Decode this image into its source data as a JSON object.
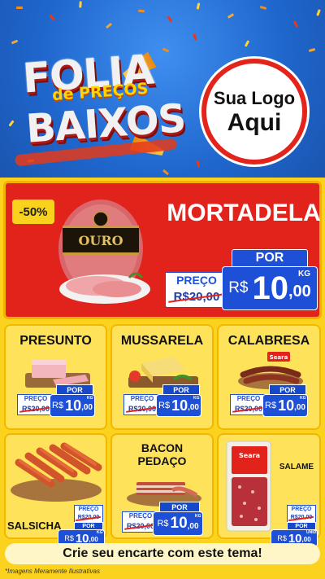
{
  "header": {
    "title_line1": "FOLIA",
    "title_line2": "de PREÇOS",
    "title_line3": "BAIXOS",
    "logo_line1": "Sua Logo",
    "logo_line2": "Aqui"
  },
  "featured": {
    "discount": "-50%",
    "name": "MORTADELA",
    "brand_label": "OURO",
    "price_label": "PREÇO",
    "old_price": "R$20,00",
    "por_label": "POR",
    "currency": "R$",
    "price_int": "10",
    "price_cents": ",00",
    "unit": "KG"
  },
  "products": [
    {
      "name": "PRESUNTO",
      "preco_label": "PREÇO",
      "old_price": "R$20,00",
      "por_label": "POR",
      "currency": "R$",
      "price_int": "10",
      "price_cents": ",00",
      "unit": "KG"
    },
    {
      "name": "MUSSARELA",
      "preco_label": "PREÇO",
      "old_price": "R$20,00",
      "por_label": "POR",
      "currency": "R$",
      "price_int": "10",
      "price_cents": ",00",
      "unit": "KG"
    },
    {
      "name": "CALABRESA",
      "preco_label": "PREÇO",
      "old_price": "R$20,00",
      "por_label": "POR",
      "currency": "R$",
      "price_int": "10",
      "price_cents": ",00",
      "unit": "KG",
      "brand": "Seara"
    },
    {
      "name": "SALSICHA",
      "preco_label": "PREÇO",
      "old_price": "R$20,00",
      "por_label": "POR",
      "currency": "R$",
      "price_int": "10",
      "price_cents": ",00",
      "unit": "KG"
    },
    {
      "name_line1": "BACON",
      "name_line2": "PEDAÇO",
      "preco_label": "PREÇO",
      "old_price": "R$20,00",
      "por_label": "POR",
      "currency": "R$",
      "price_int": "10",
      "price_cents": ",00",
      "unit": "KG"
    },
    {
      "name": "SALAME",
      "preco_label": "PREÇO",
      "old_price": "R$20,00",
      "por_label": "POR",
      "currency": "R$",
      "price_int": "10",
      "price_cents": ",00",
      "unit": "UNID.",
      "brand": "Seara"
    }
  ],
  "cta": "Crie seu encarte com este tema!",
  "footnote": "*Imagens Meramente Ilustrativas",
  "colors": {
    "header_blue": "#1f66cc",
    "featured_red": "#e2231b",
    "background_yellow": "#fbd31e",
    "price_blue": "#1d50d6"
  }
}
